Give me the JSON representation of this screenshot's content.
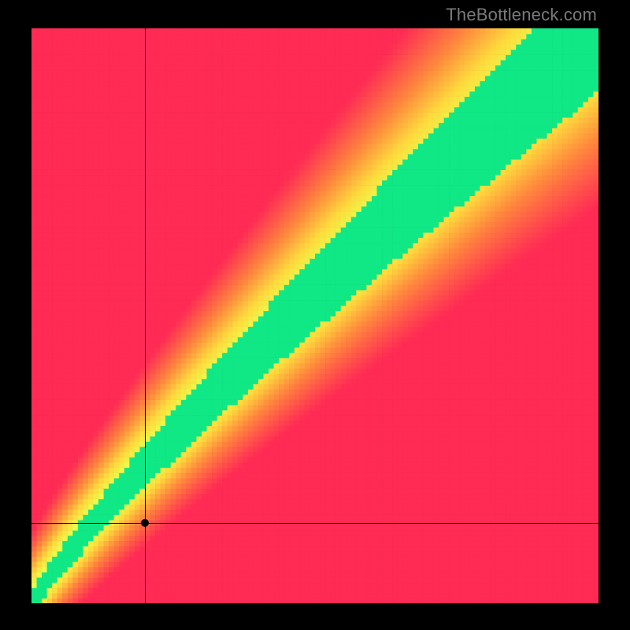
{
  "watermark": "TheBottleneck.com",
  "chart_data": {
    "type": "heatmap",
    "title": "",
    "xlabel": "",
    "ylabel": "",
    "xlim": [
      0,
      100
    ],
    "ylim": [
      0,
      100
    ],
    "crosshair": {
      "x": 20,
      "y": 14
    },
    "marker": {
      "x": 20,
      "y": 14
    },
    "optimal_curve_description": "A diagonal ridge of zero-bottleneck (green) running from the bottom-left origin toward the top-right corner, with a slight upward convexity. Values fall off toward red in the top-left (GPU far exceeds CPU) and bottom-right (CPU far exceeds GPU).",
    "color_stops": [
      {
        "value": 0.0,
        "color": "#ff2b55",
        "meaning": "severe bottleneck"
      },
      {
        "value": 0.35,
        "color": "#ff8a3d",
        "meaning": "high bottleneck"
      },
      {
        "value": 0.6,
        "color": "#ffd93d",
        "meaning": "moderate bottleneck"
      },
      {
        "value": 0.8,
        "color": "#e8ff4d",
        "meaning": "mild bottleneck"
      },
      {
        "value": 1.0,
        "color": "#10e886",
        "meaning": "balanced / no bottleneck"
      }
    ],
    "grid": false,
    "legend": false,
    "resolution_cells": 110
  }
}
